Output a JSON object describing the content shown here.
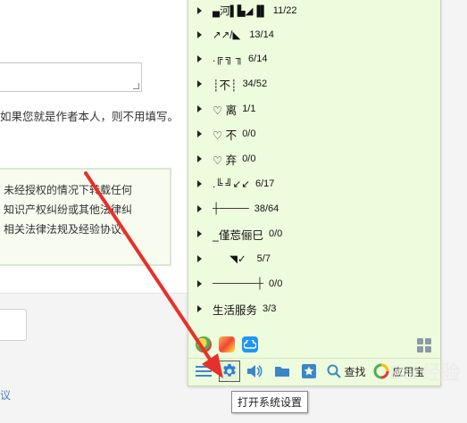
{
  "background": {
    "author_hint": "如果您就是作者本人，则不用填写。",
    "notice_lines": [
      "未经授权的情况下转载任何",
      "知识产权纠纷或其他法律纠",
      "相关法律法规及经验协议，"
    ],
    "footer_link": "议"
  },
  "panel": {
    "rows": [
      {
        "label": "▄河▌▙◢▐▌",
        "count": "11/22",
        "caret": true
      },
      {
        "label": "↗↗/◣",
        "count": "13/14",
        "caret": true
      },
      {
        "label": ".╔ ╗ ╖",
        "count": "6/14",
        "caret": true
      },
      {
        "label": "┊不┊",
        "count": "34/52",
        "caret": true
      },
      {
        "label": "♡ 离",
        "count": "1/1",
        "caret": true
      },
      {
        "label": "♡ 不",
        "count": "0/0",
        "caret": true
      },
      {
        "label": "♡ 弃",
        "count": "0/0",
        "caret": true
      },
      {
        "label": ".╚ ╝↙↙",
        "count": "6/17",
        "caret": true
      },
      {
        "label": "┼────",
        "count": "38/64",
        "caret": true
      },
      {
        "label": "_僅莣俪巳",
        "count": "0/0",
        "caret": true
      },
      {
        "label": "      ◥✓",
        "count": "5/7",
        "caret": true
      },
      {
        "label": "──────┼",
        "count": "0/0",
        "caret": true
      },
      {
        "label": "生活服务",
        "count": "3/3",
        "caret": true
      }
    ],
    "app_icons": [
      "qq-browser-icon",
      "album-icon",
      "weiyun-icon"
    ],
    "more_apps_icon": "grid-icon",
    "toolbar": {
      "menu_icon": "menu-icon",
      "settings_icon": "gear-icon",
      "volume_icon": "speaker-icon",
      "file_icon": "folder-icon",
      "favorite_icon": "star-icon",
      "search_label": "查找",
      "appstore_label": "应用宝"
    }
  },
  "tooltip": "打开系统设置",
  "colors": {
    "panel_bg": "#eefcde",
    "arrow": "#e8302a",
    "gear": "#2b7fd1"
  },
  "watermark": "Bai 经验"
}
